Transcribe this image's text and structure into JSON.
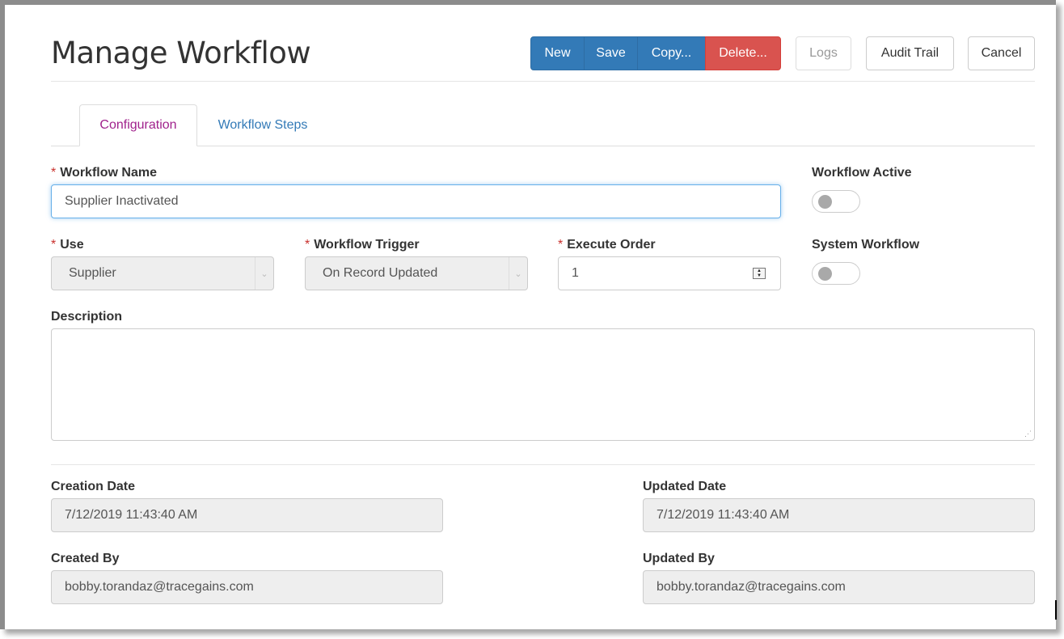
{
  "header": {
    "title": "Manage Workflow",
    "buttons": {
      "new": "New",
      "save": "Save",
      "copy": "Copy...",
      "delete": "Delete...",
      "logs": "Logs",
      "audit_trail": "Audit Trail",
      "cancel": "Cancel"
    }
  },
  "tabs": [
    {
      "label": "Configuration",
      "active": true
    },
    {
      "label": "Workflow Steps",
      "active": false
    }
  ],
  "form": {
    "workflow_name": {
      "label": "Workflow Name",
      "required": "*",
      "value": "Supplier Inactivated"
    },
    "workflow_active": {
      "label": "Workflow Active",
      "on": false
    },
    "use": {
      "label": "Use",
      "required": "*",
      "value": "Supplier"
    },
    "workflow_trigger": {
      "label": "Workflow Trigger",
      "required": "*",
      "value": "On Record Updated"
    },
    "execute_order": {
      "label": "Execute Order",
      "required": "*",
      "value": "1"
    },
    "system_workflow": {
      "label": "System Workflow",
      "on": false
    },
    "description": {
      "label": "Description",
      "value": ""
    },
    "creation_date": {
      "label": "Creation Date",
      "value": "7/12/2019 11:43:40 AM"
    },
    "updated_date": {
      "label": "Updated Date",
      "value": "7/12/2019 11:43:40 AM"
    },
    "created_by": {
      "label": "Created By",
      "value": "bobby.torandaz@tracegains.com"
    },
    "updated_by": {
      "label": "Updated By",
      "value": "bobby.torandaz@tracegains.com"
    }
  },
  "colors": {
    "primary": "#337ab7",
    "danger": "#d9534f",
    "active_tab": "#a0218c",
    "required": "#c9302c"
  },
  "icons": {
    "select_arrow": "chevron-down-icon",
    "spinner": "spinner-arrows-icon",
    "resize": "resize-grip-icon"
  }
}
